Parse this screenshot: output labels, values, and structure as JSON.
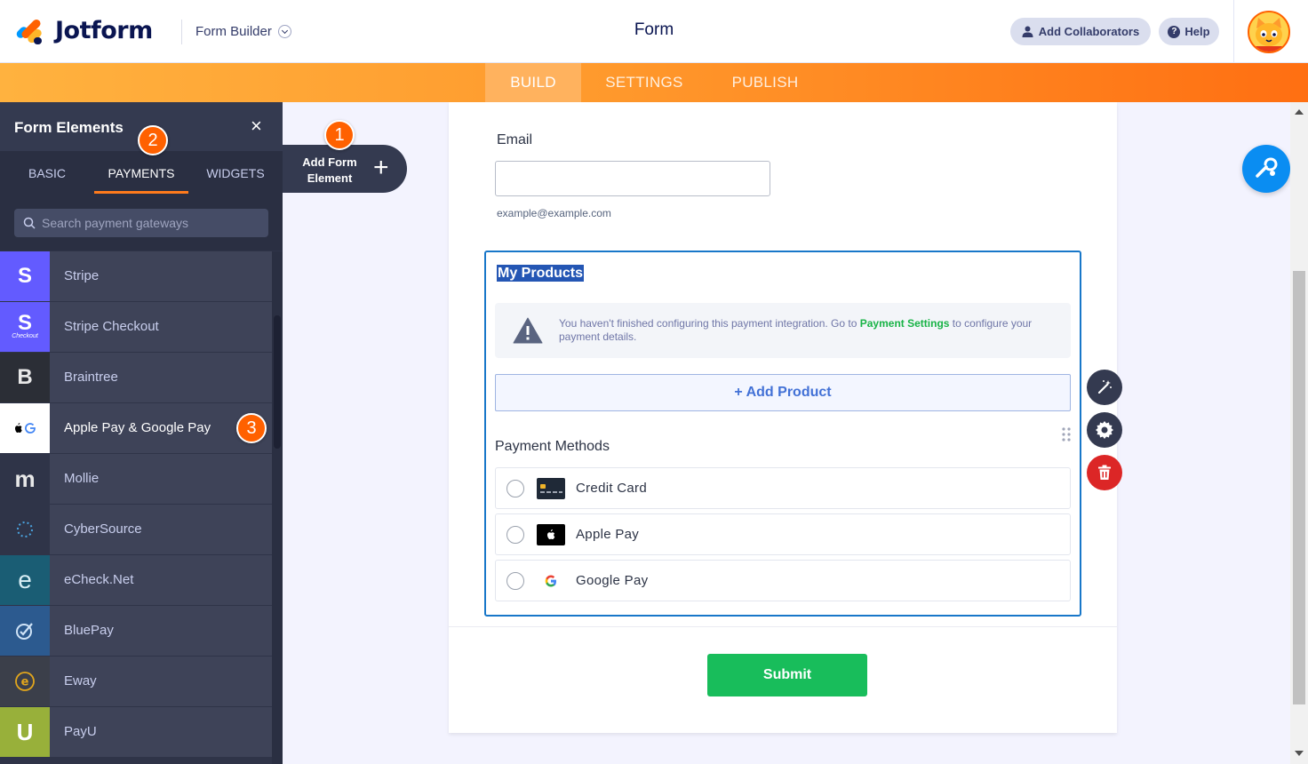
{
  "header": {
    "logo_text": "Jotform",
    "builder_menu": "Form Builder",
    "form_title": "Form",
    "add_collaborators": "Add Collaborators",
    "help": "Help"
  },
  "topnav": {
    "tabs": [
      {
        "label": "BUILD",
        "active": true
      },
      {
        "label": "SETTINGS",
        "active": false
      },
      {
        "label": "PUBLISH",
        "active": false
      }
    ]
  },
  "sidebar": {
    "title": "Form Elements",
    "close": "×",
    "tabs": [
      {
        "label": "BASIC",
        "active": false
      },
      {
        "label": "PAYMENTS",
        "active": true
      },
      {
        "label": "WIDGETS",
        "active": false
      }
    ],
    "search_placeholder": "Search payment gateways",
    "gateways": [
      {
        "label": "Stripe",
        "icon": "S",
        "color": "#635bff"
      },
      {
        "label": "Stripe Checkout",
        "icon": "S",
        "sub": "Checkout",
        "color": "#635bff"
      },
      {
        "label": "Braintree",
        "icon": "B",
        "color": "#2d2d2d"
      },
      {
        "label": "Apple Pay & Google Pay",
        "icon": "apple-google-icon",
        "color": "#ffffff"
      },
      {
        "label": "Mollie",
        "icon": "m",
        "color": "#2f3448"
      },
      {
        "label": "CyberSource",
        "icon": "cybersource-icon",
        "color": "#2f3448"
      },
      {
        "label": "eCheck.Net",
        "icon": "e",
        "color": "#1a5d74"
      },
      {
        "label": "BluePay",
        "icon": "bluepay-icon",
        "color": "#2c5a8f"
      },
      {
        "label": "Eway",
        "icon": "eway-icon",
        "color": "#3b3f4a"
      },
      {
        "label": "PayU",
        "icon": "U",
        "color": "#98b03a"
      }
    ]
  },
  "add_element": {
    "label": "Add Form Element",
    "plus": "+"
  },
  "badges": [
    "1",
    "2",
    "3"
  ],
  "form": {
    "email_label": "Email",
    "email_sublabel": "example@example.com",
    "products_title": "My Products",
    "warning_text_1": "You haven't finished configuring this payment integration. Go to",
    "warning_link": "Payment Settings",
    "warning_text_2": "to configure your payment details.",
    "add_product": "+ Add Product",
    "payment_methods_label": "Payment Methods",
    "payment_methods": [
      {
        "name": "Credit Card",
        "icon": "credit-card-icon"
      },
      {
        "name": "Apple Pay",
        "icon": "apple-icon"
      },
      {
        "name": "Google Pay",
        "icon": "google-icon"
      }
    ],
    "submit": "Submit"
  },
  "colors": {
    "accent_orange": "#ff6100",
    "submit_green": "#18bd5b",
    "selection_blue": "#1877c9",
    "delete_red": "#dc2626"
  }
}
